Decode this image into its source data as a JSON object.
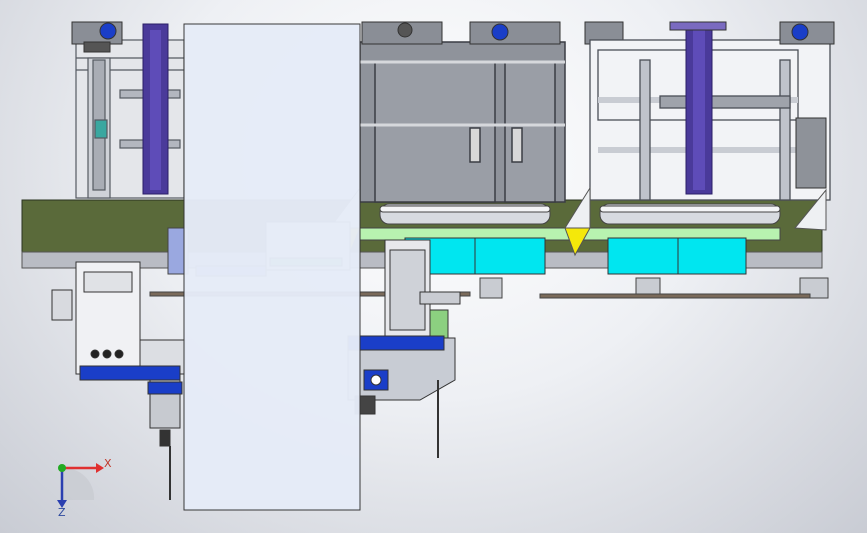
{
  "triad": {
    "x_label": "X",
    "z_label": "Z",
    "x_color": "#e03030",
    "y_color": "#22aa22",
    "z_color": "#2a3fb0"
  },
  "colors": {
    "frame": "#bfc3cc",
    "frame_dark": "#6a6e76",
    "olive": "#5a6a3a",
    "purple": "#4a3a9a",
    "cyan": "#00e6f0",
    "yellow": "#f4e80a",
    "panel": "#e6ecf8",
    "motor_blue": "#1a3ec8"
  }
}
